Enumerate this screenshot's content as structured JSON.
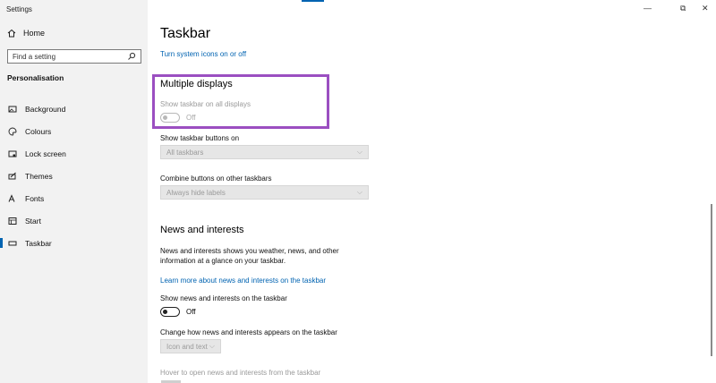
{
  "window": {
    "app_title": "Settings",
    "minimize": "—",
    "maximize": "⧉",
    "close": "✕"
  },
  "sidebar": {
    "home_label": "Home",
    "search_placeholder": "Find a setting",
    "section": "Personalisation",
    "items": [
      {
        "label": "Background",
        "icon": "picture-icon"
      },
      {
        "label": "Colours",
        "icon": "palette-icon"
      },
      {
        "label": "Lock screen",
        "icon": "lock-screen-icon"
      },
      {
        "label": "Themes",
        "icon": "themes-icon"
      },
      {
        "label": "Fonts",
        "icon": "fonts-icon"
      },
      {
        "label": "Start",
        "icon": "start-icon"
      },
      {
        "label": "Taskbar",
        "icon": "taskbar-icon",
        "active": true
      }
    ]
  },
  "main": {
    "title": "Taskbar",
    "system_icons_link": "Turn system icons on or off",
    "multiple_displays": {
      "heading": "Multiple displays",
      "show_taskbar_label": "Show taskbar on all displays",
      "show_taskbar_state": "Off",
      "buttons_on_label": "Show taskbar buttons on",
      "buttons_on_value": "All taskbars",
      "combine_label": "Combine buttons on other taskbars",
      "combine_value": "Always hide labels"
    },
    "news": {
      "heading": "News and interests",
      "description": "News and interests shows you weather, news, and other information at a glance on your taskbar.",
      "learn_more_link": "Learn more about news and interests on the taskbar",
      "show_label": "Show news and interests on the taskbar",
      "show_state": "Off",
      "appearance_label": "Change how news and interests appears on the taskbar",
      "appearance_value": "Icon and text",
      "hover_label": "Hover to open news and interests from the taskbar"
    }
  },
  "colors": {
    "accent": "#0063b1",
    "highlight": "#9b4fc1",
    "sidebar_bg": "#f2f2f2"
  }
}
